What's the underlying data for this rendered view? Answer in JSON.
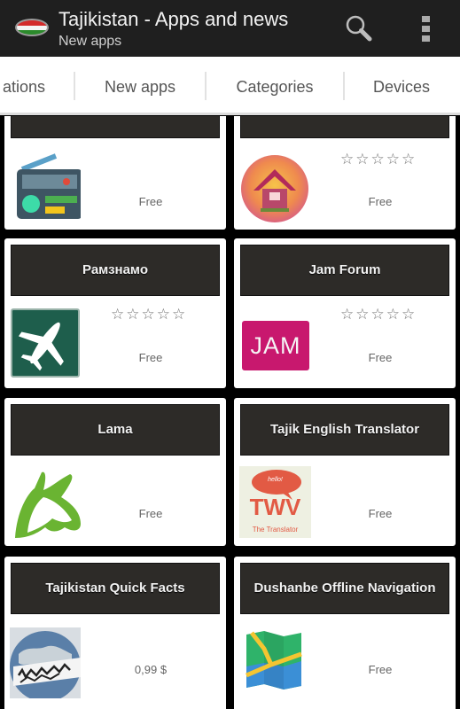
{
  "action_bar": {
    "title": "Tajikistan - Apps and news",
    "subtitle": "New apps",
    "flag_icon": "tajikistan-flag-icon",
    "search_icon": "search-icon",
    "overflow_icon": "overflow-menu-icon"
  },
  "tabs": [
    {
      "label": "ations"
    },
    {
      "label": "New apps"
    },
    {
      "label": "Categories"
    },
    {
      "label": "Devices"
    }
  ],
  "apps": [
    {
      "name": "",
      "price": "Free",
      "stars": "",
      "icon": "radio-icon"
    },
    {
      "name": "",
      "price": "Free",
      "stars": "☆☆☆☆☆",
      "icon": "house-icon"
    },
    {
      "name": "Рамзнамо",
      "price": "Free",
      "stars": "☆☆☆☆☆",
      "icon": "airplane-icon"
    },
    {
      "name": "Jam Forum",
      "price": "Free",
      "stars": "☆☆☆☆☆",
      "icon": "jam-logo-icon",
      "icon_text": "JAM"
    },
    {
      "name": "Lama",
      "price": "Free",
      "stars": "",
      "icon": "llama-icon"
    },
    {
      "name": "Tajik English Translator",
      "price": "Free",
      "stars": "",
      "icon": "translator-icon",
      "icon_text": "TWV",
      "icon_subtext": "The Translator",
      "icon_bubble": "hello!"
    },
    {
      "name": "Tajikistan Quick Facts",
      "price": "0,99 $",
      "stars": "",
      "icon": "globe-icon"
    },
    {
      "name": "Dushanbe Offline Navigation",
      "price": "Free",
      "stars": "",
      "icon": "map-icon"
    }
  ],
  "colors": {
    "action_bar": "#1f1f1f",
    "card_header": "#2d2b28",
    "jam_pink": "#c8186e",
    "airplane_green": "#1e5e4c",
    "llama_green": "#6ab432"
  }
}
